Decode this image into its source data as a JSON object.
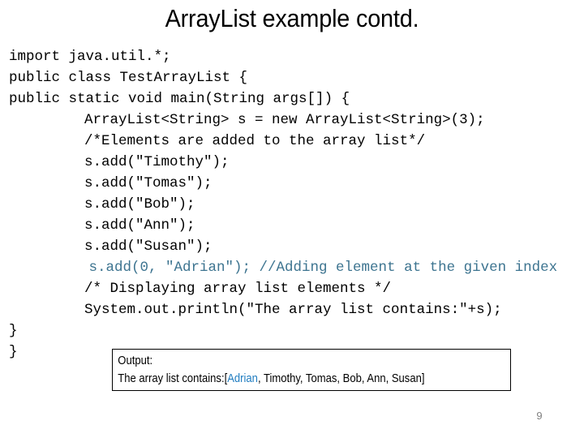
{
  "slide": {
    "title": "ArrayList example contd.",
    "page_number": "9",
    "background_color": "#ffffff"
  },
  "code": {
    "language": "java",
    "text_color": "#000000",
    "highlight_color": "#3d7490",
    "lines": [
      {
        "text": "import java.util.*;",
        "indent": "i0",
        "color": "#000000"
      },
      {
        "text": "public class TestArrayList {",
        "indent": "i0",
        "color": "#000000"
      },
      {
        "text": "public static void main(String args[]) {",
        "indent": "i0",
        "color": "#000000"
      },
      {
        "text": "ArrayList<String> s = new ArrayList<String>(3);",
        "indent": "i1",
        "color": "#000000"
      },
      {
        "text": "/*Elements are added to the array list*/",
        "indent": "i1",
        "color": "#000000"
      },
      {
        "text": "s.add(\"Timothy\");",
        "indent": "i1",
        "color": "#000000"
      },
      {
        "text": "s.add(\"Tomas\");",
        "indent": "i1",
        "color": "#000000"
      },
      {
        "text": "s.add(\"Bob\");",
        "indent": "i1",
        "color": "#000000"
      },
      {
        "text": "s.add(\"Ann\");",
        "indent": "i1",
        "color": "#000000"
      },
      {
        "text": "s.add(\"Susan\");",
        "indent": "i1",
        "color": "#000000"
      },
      {
        "text": " s.add(0, \"Adrian\"); //Adding element at the given index",
        "indent": "i2",
        "color": "#3d7490"
      },
      {
        "text": "/* Displaying array list elements */",
        "indent": "i1",
        "color": "#000000"
      },
      {
        "text": "System.out.println(\"The array list contains:\"+s);",
        "indent": "i1",
        "color": "#000000"
      },
      {
        "text": "}",
        "indent": "brace",
        "color": "#000000"
      },
      {
        "text": "}",
        "indent": "brace",
        "color": "#000000"
      }
    ]
  },
  "output": {
    "label": "Output:",
    "result_prefix": "The array list contains:[",
    "highlighted_item": "Adrian",
    "result_suffix": ", Timothy, Tomas, Bob, Ann, Susan]",
    "highlight_color": "#1f7cc0",
    "border_color": "#000000"
  }
}
